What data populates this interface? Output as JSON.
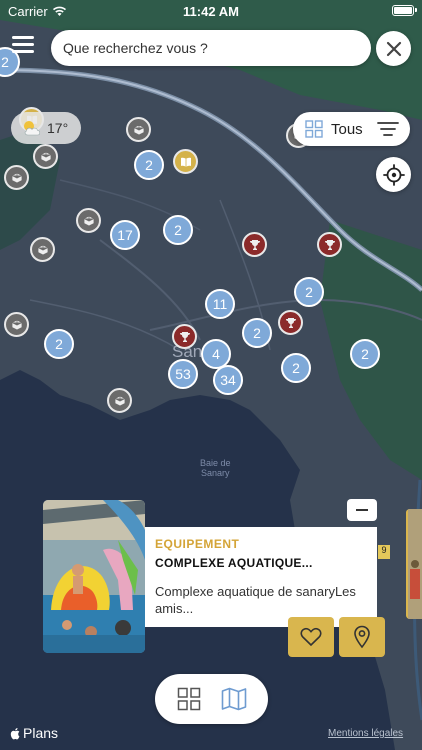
{
  "status_bar": {
    "carrier": "Carrier",
    "time": "11:42 AM"
  },
  "search": {
    "placeholder": "Que recherchez vous ?"
  },
  "weather": {
    "temperature": "17°",
    "icon": "partly-cloudy-icon"
  },
  "filter": {
    "label": "Tous"
  },
  "map": {
    "city_label": "San",
    "water_label_line1": "Baie de",
    "water_label_line2": "Sanary",
    "clusters": [
      "2",
      "2",
      "17",
      "2",
      "11",
      "2",
      "2",
      "2",
      "4",
      "2",
      "53",
      "34",
      "2"
    ]
  },
  "card": {
    "category": "EQUIPEMENT",
    "title": "COMPLEXE AQUATIQUE...",
    "description": "Complexe aquatique de sanaryLes amis...",
    "side_badge": "9"
  },
  "footer": {
    "maps_label": "Plans",
    "legal_label": "Mentions légales"
  },
  "colors": {
    "accent": "#d9b64e",
    "category_text": "#d4a437",
    "cluster": "#7fa9d8",
    "trophy": "#8b2a2a",
    "cube": "#6b6b6b"
  }
}
